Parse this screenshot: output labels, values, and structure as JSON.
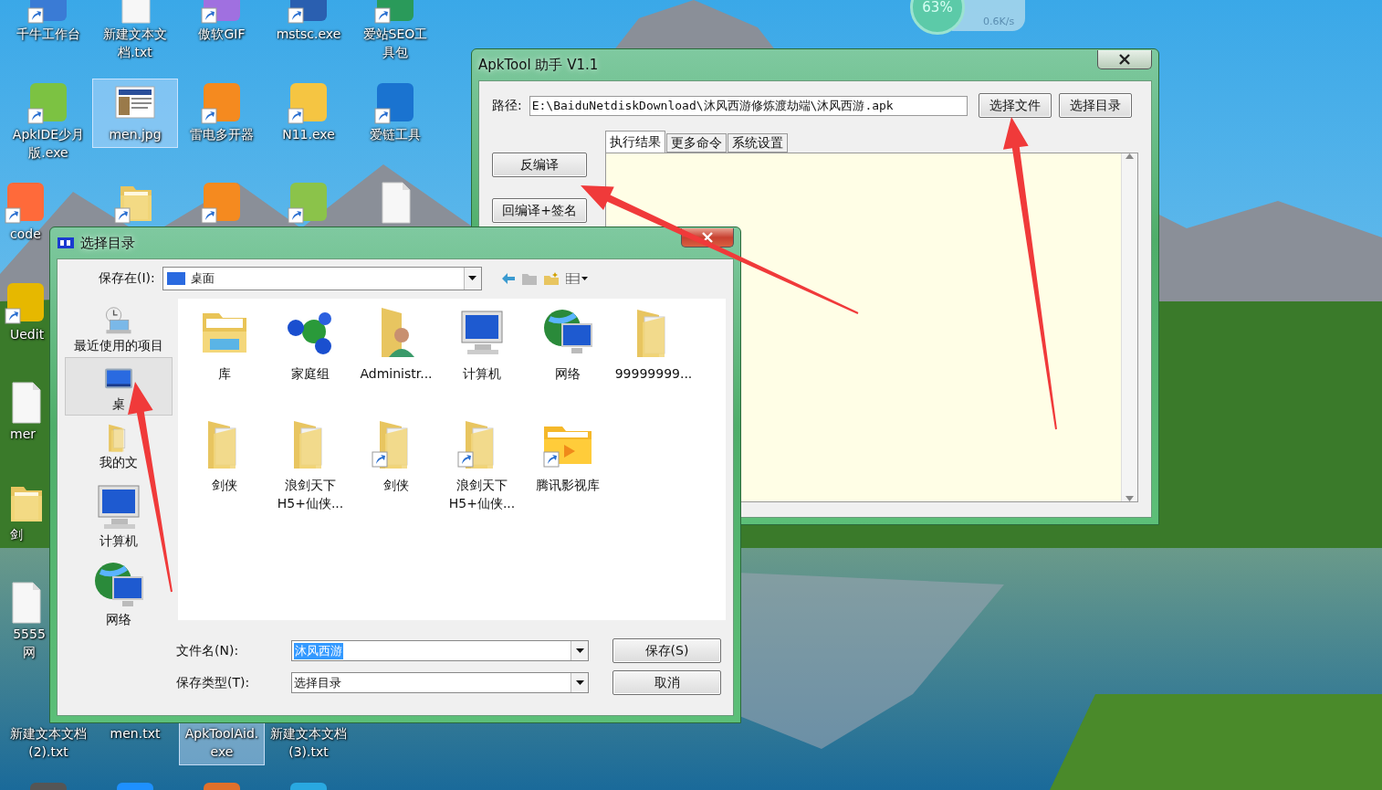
{
  "desktop": {
    "icons": [
      {
        "label": "千牛工作台",
        "kind": "app",
        "color": "#3a7bd5",
        "shortcut": true,
        "selected": false
      },
      {
        "label": "新建文本文档.txt",
        "kind": "doc",
        "shortcut": false,
        "selected": false
      },
      {
        "label": "傲软GIF",
        "kind": "app",
        "color": "#a070e0",
        "shortcut": true,
        "selected": false
      },
      {
        "label": "mstsc.exe",
        "kind": "app",
        "color": "#2a5fb0",
        "shortcut": true,
        "selected": false
      },
      {
        "label": "爱站SEO工具包",
        "kind": "app",
        "color": "#2a9a5a",
        "shortcut": true,
        "selected": false
      },
      {
        "label": "ApkIDE少月版.exe",
        "kind": "app",
        "color": "#7cc242",
        "shortcut": true,
        "selected": false
      },
      {
        "label": "men.jpg",
        "kind": "image",
        "shortcut": false,
        "selected": true
      },
      {
        "label": "雷电多开器",
        "kind": "app",
        "color": "#f58a1f",
        "shortcut": true,
        "selected": false
      },
      {
        "label": "N11.exe",
        "kind": "app",
        "color": "#f5c542",
        "shortcut": true,
        "selected": false
      },
      {
        "label": "爱链工具",
        "kind": "app",
        "color": "#1a73d0",
        "shortcut": true,
        "selected": false
      },
      {
        "label": "code",
        "kind": "app",
        "color": "#ff6a3a",
        "shortcut": true,
        "selected": false
      },
      {
        "kind": "folder",
        "shortcut": true,
        "selected": false
      },
      {
        "kind": "app",
        "color": "#f58a1f",
        "shortcut": true,
        "selected": false
      },
      {
        "kind": "app",
        "color": "#8bc34a",
        "shortcut": true,
        "selected": false
      },
      {
        "kind": "doc",
        "shortcut": false,
        "selected": false
      },
      {
        "label": "Uedit",
        "kind": "app",
        "color": "#e6b800",
        "shortcut": true,
        "selected": false
      },
      {
        "label": "mer",
        "kind": "doc",
        "shortcut": false,
        "selected": false
      },
      {
        "label": "剑",
        "kind": "folder",
        "shortcut": false,
        "selected": false
      },
      {
        "label": "5555网",
        "kind": "doc",
        "shortcut": false,
        "selected": false
      },
      {
        "label": "新建文本文档 (2).txt",
        "selected": false
      },
      {
        "label": "men.txt",
        "selected": false
      },
      {
        "label": "ApkToolAid.exe",
        "selected": true
      },
      {
        "label": "新建文本文档 (3).txt",
        "selected": false
      },
      {
        "kind": "app",
        "color": "#555555",
        "selected": false
      },
      {
        "kind": "app",
        "color": "#1e90ff",
        "selected": false
      },
      {
        "kind": "app",
        "color": "#e0702a",
        "selected": false
      },
      {
        "kind": "app",
        "color": "#29a8e0",
        "selected": false
      }
    ]
  },
  "net_widget": {
    "percent": "63%",
    "speed": "0.6K/s"
  },
  "apktool_window": {
    "title": "ApkTool 助手 V1.1",
    "path_label": "路径:",
    "path_value": "E:\\BaiduNetdiskDownload\\沐风西游修炼渡劫端\\沐风西游.apk",
    "buttons": [
      "选择文件",
      "选择目录"
    ],
    "tabs": [
      {
        "label": "执行结果",
        "selected": true
      },
      {
        "label": "更多命令",
        "selected": false
      },
      {
        "label": "系统设置",
        "selected": false
      }
    ],
    "actions": [
      "反编译",
      "回编译+签名"
    ]
  },
  "dialog": {
    "title": "选择目录",
    "save_in_label": "保存在(I):",
    "location": "桌面",
    "places": [
      {
        "label": "最近使用的项目",
        "kind": "recent",
        "selected": false
      },
      {
        "label": "桌",
        "kind": "desktop",
        "selected": true
      },
      {
        "label": "我的文",
        "kind": "documents",
        "selected": false
      },
      {
        "label": "计算机",
        "kind": "computer",
        "selected": false
      },
      {
        "label": "网络",
        "kind": "network",
        "selected": false
      }
    ],
    "files": [
      {
        "label": "库",
        "kind": "library",
        "shortcut": false
      },
      {
        "label": "家庭组",
        "kind": "homegroup",
        "shortcut": false
      },
      {
        "label": "Administr...",
        "kind": "user",
        "shortcut": false
      },
      {
        "label": "计算机",
        "kind": "computer",
        "shortcut": false
      },
      {
        "label": "网络",
        "kind": "network",
        "shortcut": false
      },
      {
        "label": "99999999...",
        "kind": "folder",
        "shortcut": false
      },
      {
        "label": "剑侠",
        "kind": "folder",
        "shortcut": false
      },
      {
        "label": "浪剑天下 H5+仙侠...",
        "kind": "folder",
        "shortcut": false
      },
      {
        "label": "剑侠",
        "kind": "folder",
        "shortcut": true
      },
      {
        "label": "浪剑天下 H5+仙侠...",
        "kind": "folder",
        "shortcut": true
      },
      {
        "label": "腾讯影视库",
        "kind": "media",
        "shortcut": true
      }
    ],
    "filename_label": "文件名(N):",
    "filename": "沐风西游",
    "filetype_label": "保存类型(T):",
    "filetype": "选择目录",
    "buttons": [
      "保存(S)",
      "取消"
    ]
  }
}
